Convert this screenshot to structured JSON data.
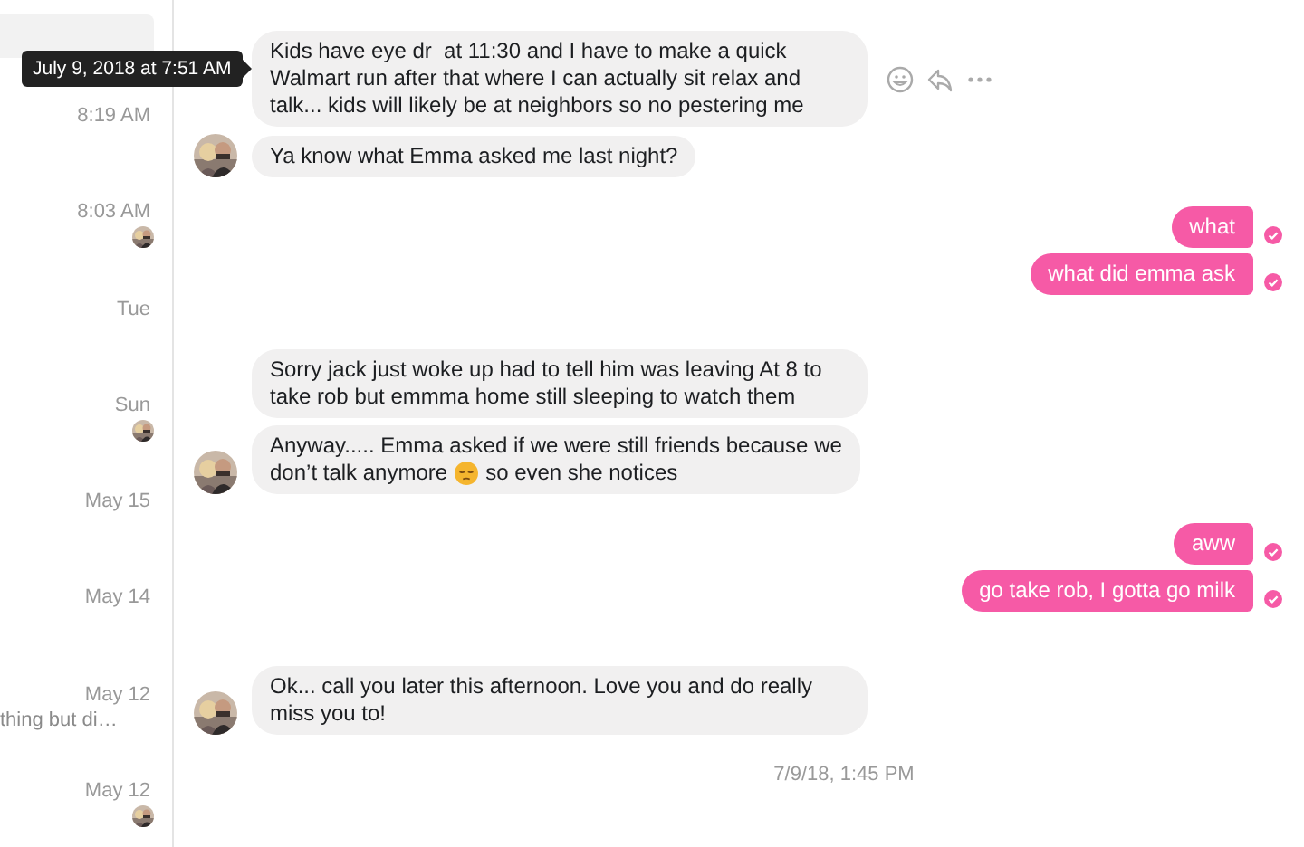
{
  "tooltip": "July 9, 2018 at 7:51 AM",
  "sidebar": {
    "items": [
      {
        "selected": true
      },
      {
        "time": "8:19 AM",
        "selected": false,
        "seen_avatar": false
      },
      {
        "time": "8:03 AM",
        "selected": false,
        "seen_avatar": true
      },
      {
        "time": "Tue",
        "selected": false,
        "seen_avatar": false
      },
      {
        "time": "Sun",
        "selected": false,
        "seen_avatar": true
      },
      {
        "time": "May 15",
        "selected": false,
        "seen_avatar": false
      },
      {
        "time": "May 14",
        "selected": false,
        "seen_avatar": false
      },
      {
        "time": "May 12",
        "snippet": "thing but di…",
        "selected": false,
        "seen_avatar": false
      },
      {
        "time": "May 12",
        "selected": false,
        "seen_avatar": true
      }
    ]
  },
  "messages": [
    {
      "kind": "incoming",
      "text": "Kids have eye dr  at 11:30 and I have to make a quick Walmart run after that where I can actually sit relax and talk... kids will likely be at neighbors so no pestering me",
      "hovered": true,
      "avatar": false
    },
    {
      "kind": "incoming",
      "text": "Ya know what Emma asked me last night?",
      "hovered": false,
      "avatar": true
    },
    {
      "kind": "outgoing",
      "text": "what",
      "delivered": true
    },
    {
      "kind": "outgoing",
      "text": "what did emma ask",
      "delivered": true
    },
    {
      "kind": "incoming",
      "text": "Sorry jack just woke up had to tell him was leaving At 8 to take rob but emmma home still sleeping to watch them",
      "hovered": false,
      "avatar": false
    },
    {
      "kind": "incoming",
      "lines": [
        [
          {
            "kind": "text",
            "text": "Anyway..... Emma asked if we were still friends because we"
          }
        ],
        [
          {
            "kind": "text",
            "text": "don’t talk anymore"
          },
          {
            "kind": "emoji"
          },
          {
            "kind": "text",
            "text": "so even she notices"
          }
        ]
      ],
      "hovered": false,
      "avatar": true
    },
    {
      "kind": "outgoing",
      "text": "aww",
      "delivered": true
    },
    {
      "kind": "outgoing",
      "text": "go take rob, I gotta go milk",
      "delivered": true
    },
    {
      "kind": "incoming",
      "text": "Ok... call you later this afternoon. Love you and do really miss you to!",
      "hovered": false,
      "avatar": true
    }
  ],
  "timestamp": "7/9/18, 1:45 PM"
}
